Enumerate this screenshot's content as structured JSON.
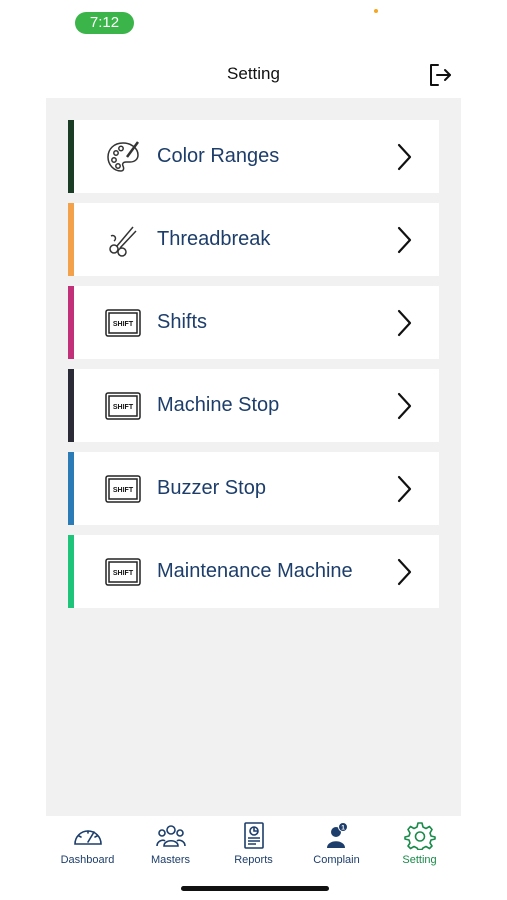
{
  "status": {
    "time": "7:12"
  },
  "header": {
    "title": "Setting"
  },
  "menu": [
    {
      "label": "Color Ranges",
      "accent": "#1b3d26",
      "icon": "palette-icon"
    },
    {
      "label": "Threadbreak",
      "accent": "#f3a24b",
      "icon": "scissors-icon"
    },
    {
      "label": "Shifts",
      "accent": "#c2307a",
      "icon": "shift-key-icon"
    },
    {
      "label": "Machine Stop",
      "accent": "#2b2b38",
      "icon": "shift-key-icon"
    },
    {
      "label": "Buzzer Stop",
      "accent": "#2b7bb7",
      "icon": "shift-key-icon"
    },
    {
      "label": "Maintenance Machine",
      "accent": "#1fc47b",
      "icon": "shift-key-icon"
    }
  ],
  "shift_key_text": "SHIFT",
  "tabs": [
    {
      "label": "Dashboard",
      "icon": "speedometer-icon"
    },
    {
      "label": "Masters",
      "icon": "users-icon"
    },
    {
      "label": "Reports",
      "icon": "report-icon"
    },
    {
      "label": "Complain",
      "icon": "user-badge-icon",
      "badge": "1"
    },
    {
      "label": "Setting",
      "icon": "gear-icon",
      "active": true
    }
  ],
  "colors": {
    "text": "#1d3e6b",
    "active_tab": "#1a8a4a",
    "panel": "#f1f1f1",
    "status_pill": "#3bb54a"
  }
}
